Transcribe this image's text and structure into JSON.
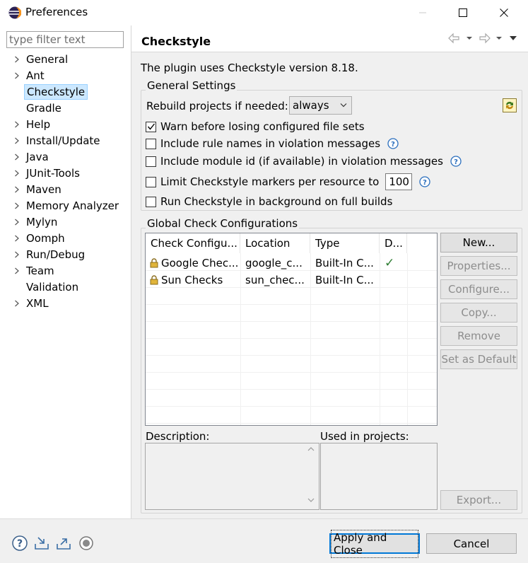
{
  "window": {
    "title": "Preferences"
  },
  "filter": {
    "placeholder": "type filter text"
  },
  "tree": [
    {
      "label": "General",
      "expandable": true
    },
    {
      "label": "Ant",
      "expandable": true
    },
    {
      "label": "Checkstyle",
      "expandable": false,
      "selected": true
    },
    {
      "label": "Gradle",
      "expandable": false
    },
    {
      "label": "Help",
      "expandable": true
    },
    {
      "label": "Install/Update",
      "expandable": true
    },
    {
      "label": "Java",
      "expandable": true
    },
    {
      "label": "JUnit-Tools",
      "expandable": true
    },
    {
      "label": "Maven",
      "expandable": true
    },
    {
      "label": "Memory Analyzer",
      "expandable": true
    },
    {
      "label": "Mylyn",
      "expandable": true
    },
    {
      "label": "Oomph",
      "expandable": true
    },
    {
      "label": "Run/Debug",
      "expandable": true
    },
    {
      "label": "Team",
      "expandable": true
    },
    {
      "label": "Validation",
      "expandable": false
    },
    {
      "label": "XML",
      "expandable": true
    }
  ],
  "page": {
    "title": "Checkstyle",
    "version_text": "The plugin uses Checkstyle version 8.18."
  },
  "general": {
    "title": "General Settings",
    "rebuild_label": "Rebuild projects if needed:",
    "rebuild_value": "always",
    "warn_label": "Warn before losing configured file sets",
    "warn_checked": true,
    "rule_names_label": "Include rule names in violation messages",
    "rule_names_checked": false,
    "module_id_label": "Include module id (if available) in violation messages",
    "module_id_checked": false,
    "limit_label": "Limit Checkstyle markers per resource to",
    "limit_checked": false,
    "limit_value": "100",
    "background_label": "Run Checkstyle in background on full builds",
    "background_checked": false
  },
  "global": {
    "title": "Global Check Configurations",
    "columns": [
      "Check Configu...",
      "Location",
      "Type",
      "D..."
    ],
    "rows": [
      {
        "name": "Google Chec...",
        "location": "google_c...",
        "type": "Built-In C...",
        "default": "✓"
      },
      {
        "name": "Sun Checks",
        "location": "sun_chec...",
        "type": "Built-In C...",
        "default": ""
      }
    ],
    "buttons": {
      "new": "New...",
      "properties": "Properties...",
      "configure": "Configure...",
      "copy": "Copy...",
      "remove": "Remove",
      "set_default": "Set as Default",
      "export": "Export..."
    },
    "description_label": "Description:",
    "used_label": "Used in projects:"
  },
  "footer": {
    "apply_close": "Apply and Close",
    "cancel": "Cancel"
  },
  "colors": {
    "accent": "#0078d7",
    "selection": "#cce8ff",
    "check": "#2e7d32"
  }
}
